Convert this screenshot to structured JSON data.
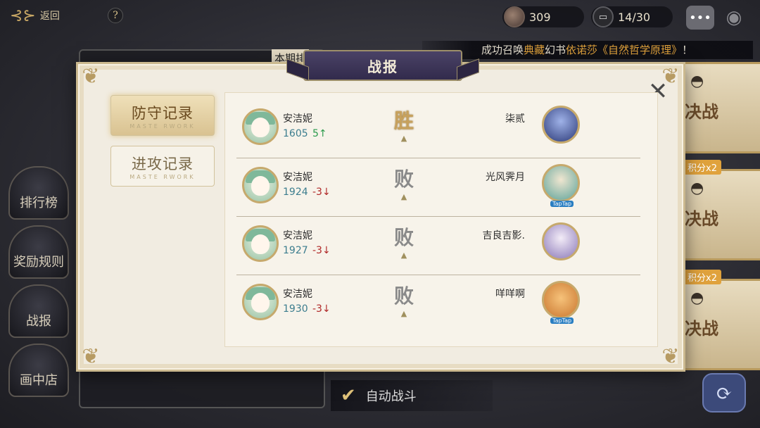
{
  "topbar": {
    "back_label": "返回",
    "help_symbol": "?",
    "coins": "309",
    "tickets": "14/30",
    "chat_symbol": "•••",
    "map_symbol": "⚲"
  },
  "marquee": {
    "prefix": "成功召唤",
    "quality": "典藏",
    "item_type": "幻书",
    "character": "依诺莎《自然哲学原理》",
    "suffix": "！"
  },
  "sidebar": {
    "items": [
      "排行榜",
      "奖励规则",
      "战报",
      "画中店"
    ]
  },
  "background": {
    "tab_fragment": "本期排",
    "fight_label": "决战",
    "multiplier_label": "积分x2",
    "auto_battle_label": "自动战斗"
  },
  "modal": {
    "title": "战报",
    "close_symbol": "✕",
    "tabs": [
      {
        "label": "防守记录",
        "sub": "MASTE RWORK",
        "active": true
      },
      {
        "label": "进攻记录",
        "sub": "MASTE RWORK",
        "active": false
      }
    ],
    "records": [
      {
        "player": "安洁妮",
        "score": "1605",
        "delta": "5↑",
        "delta_dir": "up",
        "result": "胜",
        "opponent": "柒贰"
      },
      {
        "player": "安洁妮",
        "score": "1924",
        "delta": "-3↓",
        "delta_dir": "down",
        "result": "败",
        "opponent": "光风霁月"
      },
      {
        "player": "安洁妮",
        "score": "1927",
        "delta": "-3↓",
        "delta_dir": "down",
        "result": "败",
        "opponent": "吉良吉影."
      },
      {
        "player": "安洁妮",
        "score": "1930",
        "delta": "-3↓",
        "delta_dir": "down",
        "result": "败",
        "opponent": "咩咩啊"
      }
    ],
    "badge_label": "TapTap"
  },
  "colors": {
    "win": "#c7a15d",
    "lose": "#8a8a8a",
    "delta_up": "#2a9a4b",
    "delta_down": "#b02828",
    "score": "#3c7d8e",
    "marquee_gold": "#e0a23c"
  }
}
